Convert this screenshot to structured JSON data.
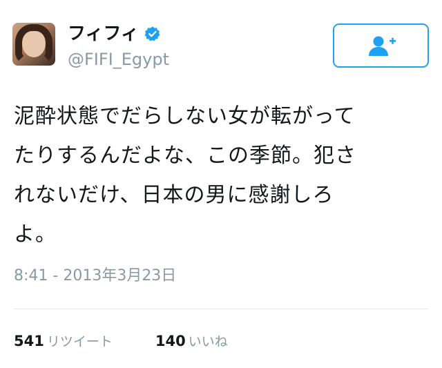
{
  "profile": {
    "display_name": "フィフィ",
    "handle": "@FIFI_Egypt",
    "verified": true,
    "avatar_icon": "user-avatar"
  },
  "follow_button": {
    "icon": "add-user-icon",
    "color": "#1da1f2"
  },
  "tweet": {
    "text": "泥酔状態でだらしない女が転がって\nたりするんだよな、この季節。犯さ\nれないだけ、日本の男に感謝しろ\nよ。",
    "timestamp": "8:41 - 2013年3月23日"
  },
  "stats": {
    "retweets": {
      "count": "541",
      "label": "リツイート"
    },
    "likes": {
      "count": "140",
      "label": "いいね"
    }
  },
  "colors": {
    "accent": "#1da1f2",
    "muted_text": "#8899a6",
    "primary_text": "#14171a",
    "divider": "#e1e8ed"
  }
}
